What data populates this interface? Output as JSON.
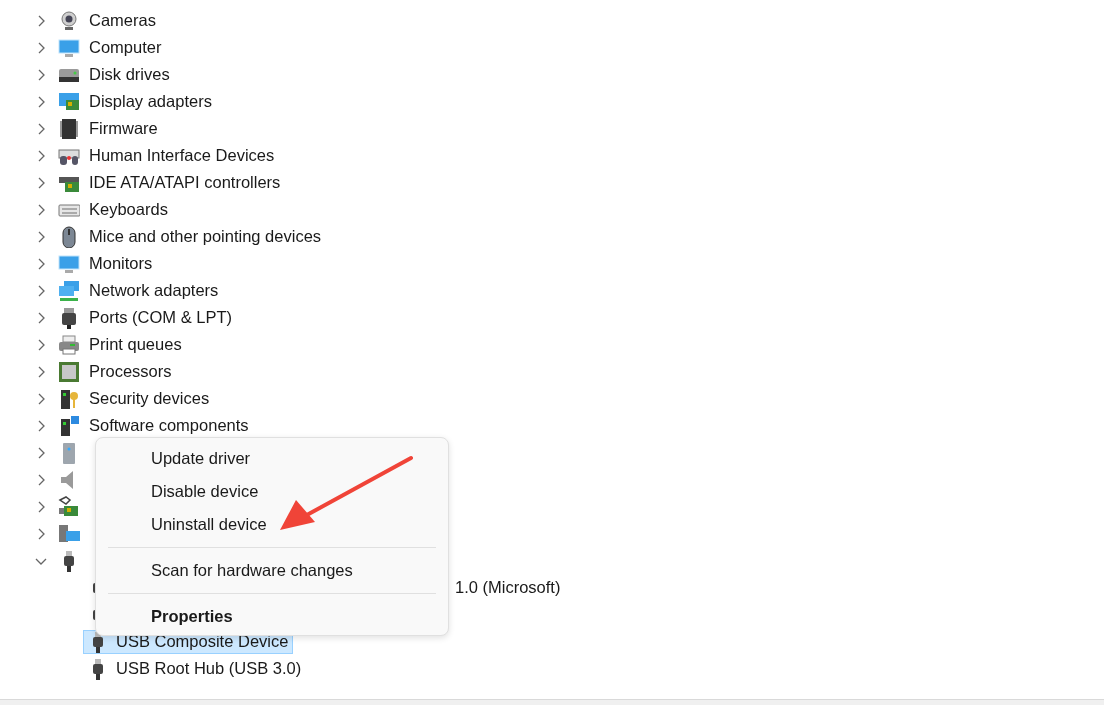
{
  "tree": [
    {
      "label": "Cameras",
      "expanded": false
    },
    {
      "label": "Computer",
      "expanded": false
    },
    {
      "label": "Disk drives",
      "expanded": false
    },
    {
      "label": "Display adapters",
      "expanded": false
    },
    {
      "label": "Firmware",
      "expanded": false
    },
    {
      "label": "Human Interface Devices",
      "expanded": false
    },
    {
      "label": "IDE ATA/ATAPI controllers",
      "expanded": false
    },
    {
      "label": "Keyboards",
      "expanded": false
    },
    {
      "label": "Mice and other pointing devices",
      "expanded": false
    },
    {
      "label": "Monitors",
      "expanded": false
    },
    {
      "label": "Network adapters",
      "expanded": false
    },
    {
      "label": "Ports (COM & LPT)",
      "expanded": false
    },
    {
      "label": "Print queues",
      "expanded": false
    },
    {
      "label": "Processors",
      "expanded": false
    },
    {
      "label": "Security devices",
      "expanded": false
    },
    {
      "label": "Software components",
      "expanded": false
    },
    {
      "expanded": false
    },
    {
      "expanded": false
    },
    {
      "expanded": false
    },
    {
      "expanded": false
    },
    {
      "expanded": true,
      "children": [
        {
          "label": "1.0 (Microsoft)",
          "covered": true,
          "selected": false
        },
        {
          "selected": false
        },
        {
          "label": "USB Composite Device",
          "selected": true
        },
        {
          "label": "USB Root Hub (USB 3.0)",
          "selected": false
        }
      ]
    }
  ],
  "context_menu": [
    {
      "kind": "item",
      "label": "Update driver"
    },
    {
      "kind": "item",
      "label": "Disable device"
    },
    {
      "kind": "item",
      "label": "Uninstall device"
    },
    {
      "kind": "separator"
    },
    {
      "kind": "item",
      "label": "Scan for hardware changes"
    },
    {
      "kind": "separator"
    },
    {
      "kind": "default",
      "label": "Properties"
    }
  ]
}
